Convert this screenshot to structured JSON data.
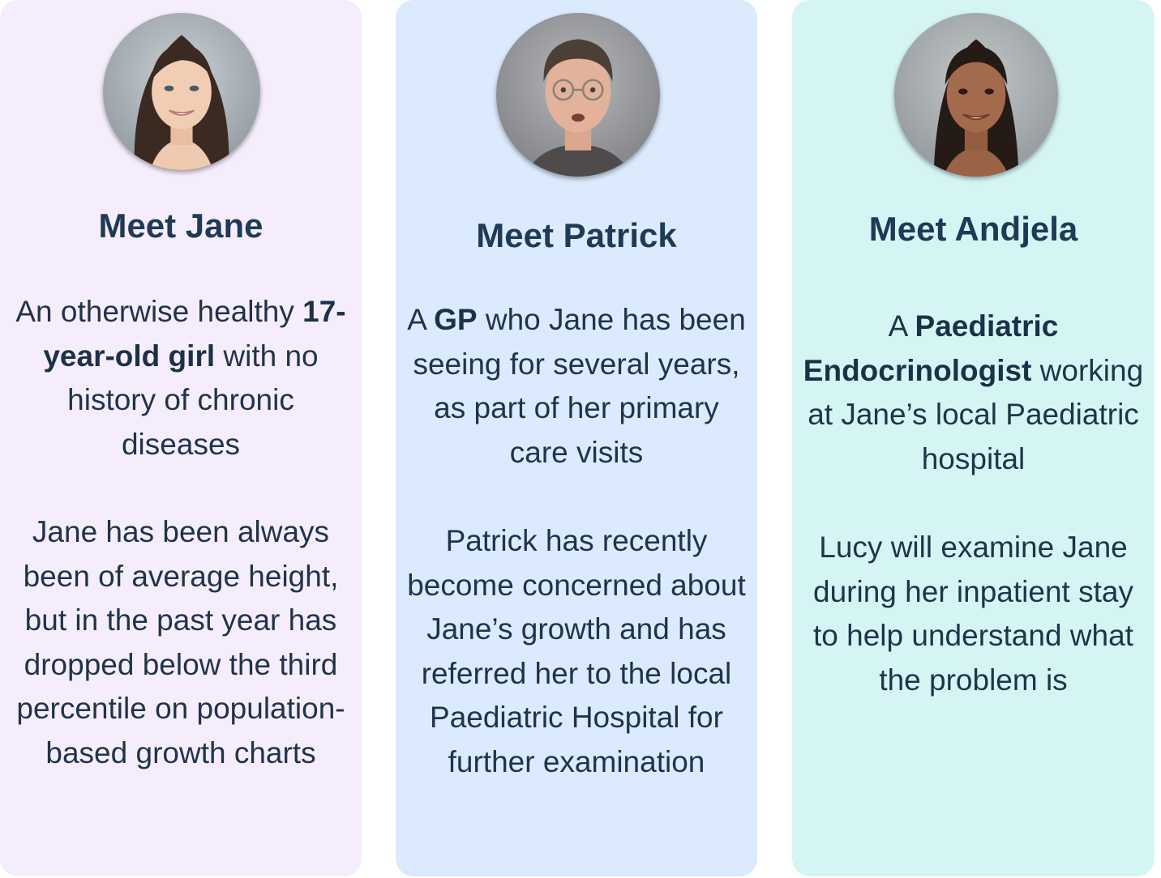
{
  "cards": [
    {
      "name": "jane",
      "title": "Meet Jane",
      "p1": {
        "before": "An otherwise healthy ",
        "bold": "17-year-old girl",
        "after": " with no history of chronic diseases"
      },
      "p2": "Jane has been always been of average height, but in the past year has dropped below the third percentile on population-based growth charts",
      "avatar": "portrait-young-woman",
      "bg": "#f6edfc"
    },
    {
      "name": "patrick",
      "title": "Meet Patrick",
      "p1": {
        "before": "A ",
        "bold": "GP",
        "after": " who Jane has been seeing for several years, as part of her primary care visits"
      },
      "p2": "Patrick has recently become concerned about Jane’s growth and has referred her to the local Paediatric Hospital for further examination",
      "avatar": "portrait-man-glasses",
      "bg": "#dbeafd"
    },
    {
      "name": "andjela",
      "title": "Meet Andjela",
      "p1": {
        "before": "A ",
        "bold": "Paediatric Endocrinologist",
        "after": " working at Jane’s local Paediatric hospital"
      },
      "p2": "Lucy will examine Jane during her inpatient stay to help understand what the problem is",
      "avatar": "portrait-woman-dark-hair",
      "bg": "#d5f5f5"
    }
  ]
}
